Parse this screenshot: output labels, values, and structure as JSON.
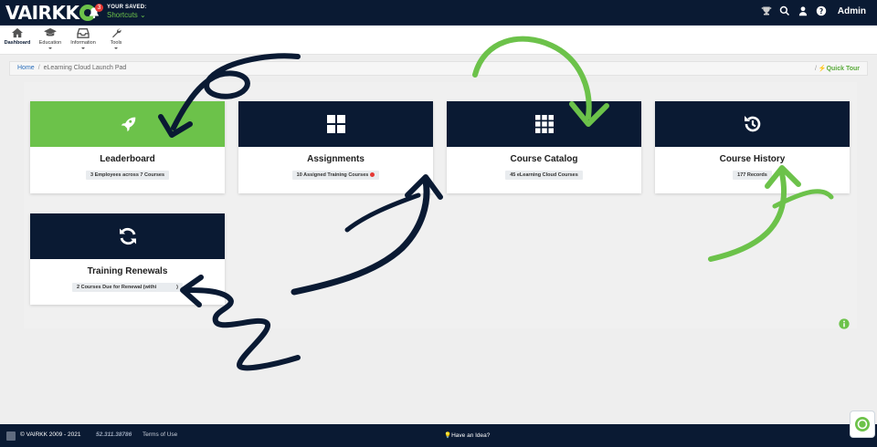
{
  "app": {
    "logo_text": "VAIRKK",
    "notification_count": "3",
    "saved_label": "YOUR SAVED:",
    "saved_value": "Shortcuts",
    "admin_label": "Admin"
  },
  "toolbar": {
    "items": [
      {
        "label": "Dashboard",
        "icon": "home-icon"
      },
      {
        "label": "Education",
        "icon": "graduation-cap-icon"
      },
      {
        "label": "Information",
        "icon": "inbox-icon"
      },
      {
        "label": "Tools",
        "icon": "wrench-icon"
      }
    ]
  },
  "breadcrumb": {
    "home": "Home",
    "separator": "/",
    "current": "eLearning Cloud Launch Pad",
    "quick_tour": "Quick Tour"
  },
  "cards": [
    {
      "title": "Leaderboard",
      "stat": "3 Employees across 7 Courses",
      "icon": "rocket-icon",
      "color": "#6cc24a"
    },
    {
      "title": "Assignments",
      "stat": "10 Assigned Training Courses",
      "icon": "grid-4-icon",
      "color": "#0a1a33"
    },
    {
      "title": "Course Catalog",
      "stat": "45 eLearning Cloud Courses",
      "icon": "grid-9-icon",
      "color": "#0a1a33"
    },
    {
      "title": "Course History",
      "stat": "177 Records",
      "icon": "history-icon",
      "color": "#0a1a33"
    },
    {
      "title": "Training Renewals",
      "stat": "2 Courses Due for Renewal (withi",
      "stat_tail": ")",
      "icon": "refresh-icon",
      "color": "#0a1a33"
    }
  ],
  "footer": {
    "copyright": "© VAIRKK 2009 - 2021",
    "version": "52.311.38786",
    "terms": "Terms of Use",
    "idea": "Have an Idea?"
  },
  "colors": {
    "navy": "#0a1a33",
    "green": "#6cc24a",
    "alert": "#e53935"
  }
}
